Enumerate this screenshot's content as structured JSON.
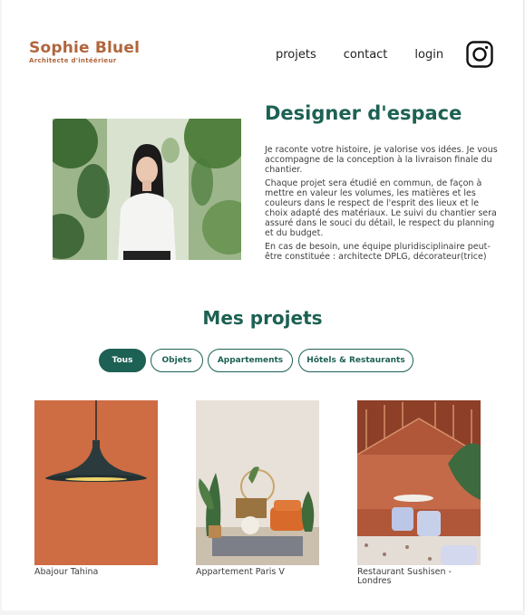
{
  "header": {
    "brand_name": "Sophie Bluel",
    "brand_subtitle": "Architecte d'intéérieur",
    "nav": [
      "projets",
      "contact",
      "login"
    ],
    "icon": "instagram-icon"
  },
  "intro": {
    "title": "Designer d'espace",
    "paragraphs": [
      "Je raconte votre histoire, je valorise vos idées. Je vous accompagne de la conception à la livraison finale du chantier.",
      "Chaque projet sera étudié en commun, de façon à mettre en valeur les volumes, les matières et les couleurs dans le respect de l'esprit des lieux et le choix adapté des matériaux. Le suivi du chantier sera assuré dans le souci du détail, le respect du planning et du budget.",
      "En cas de besoin, une équipe pluridisciplinaire peut-être constituée : architecte DPLG, décorateur(trice)"
    ]
  },
  "projects": {
    "title": "Mes projets",
    "filters": [
      "Tous",
      "Objets",
      "Appartements",
      "Hôtels & Restaurants"
    ],
    "active_filter": "Tous",
    "items": [
      {
        "caption": "Abajour Tahina"
      },
      {
        "caption": "Appartement Paris V"
      },
      {
        "caption": "Restaurant Sushisen - Londres"
      }
    ]
  },
  "colors": {
    "brand": "#b1663c",
    "accent": "#1d6154"
  }
}
